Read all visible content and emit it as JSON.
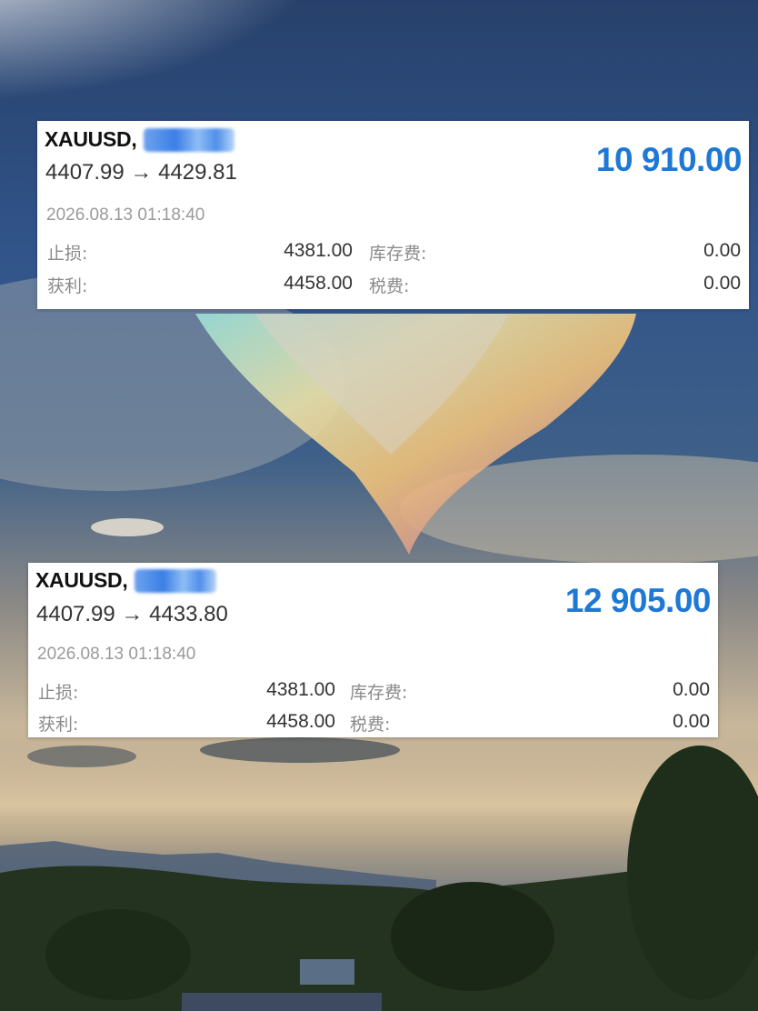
{
  "cards": [
    {
      "symbol": "XAUUSD,",
      "price_route": "4407.99 → 4429.81",
      "profit": "10 910.00",
      "datetime": "2026.08.13 01:18:40",
      "stop_loss_label": "止损:",
      "stop_loss_value": "4381.00",
      "take_profit_label": "获利:",
      "take_profit_value": "4458.00",
      "swap_label": "库存费:",
      "swap_value": "0.00",
      "tax_label": "税费:",
      "tax_value": "0.00"
    },
    {
      "symbol": "XAUUSD,",
      "price_route": "4407.99 → 4433.80",
      "profit": "12 905.00",
      "datetime": "2026.08.13 01:18:40",
      "stop_loss_label": "止损:",
      "stop_loss_value": "4381.00",
      "take_profit_label": "获利:",
      "take_profit_value": "4458.00",
      "swap_label": "库存费:",
      "swap_value": "0.00",
      "tax_label": "税费:",
      "tax_value": "0.00"
    }
  ],
  "colors": {
    "profit_blue": "#1d78d6",
    "redaction_blue": "#3a7fe6"
  },
  "background": {
    "description_icon": "sky-with-iridescent-cloud-photo"
  }
}
